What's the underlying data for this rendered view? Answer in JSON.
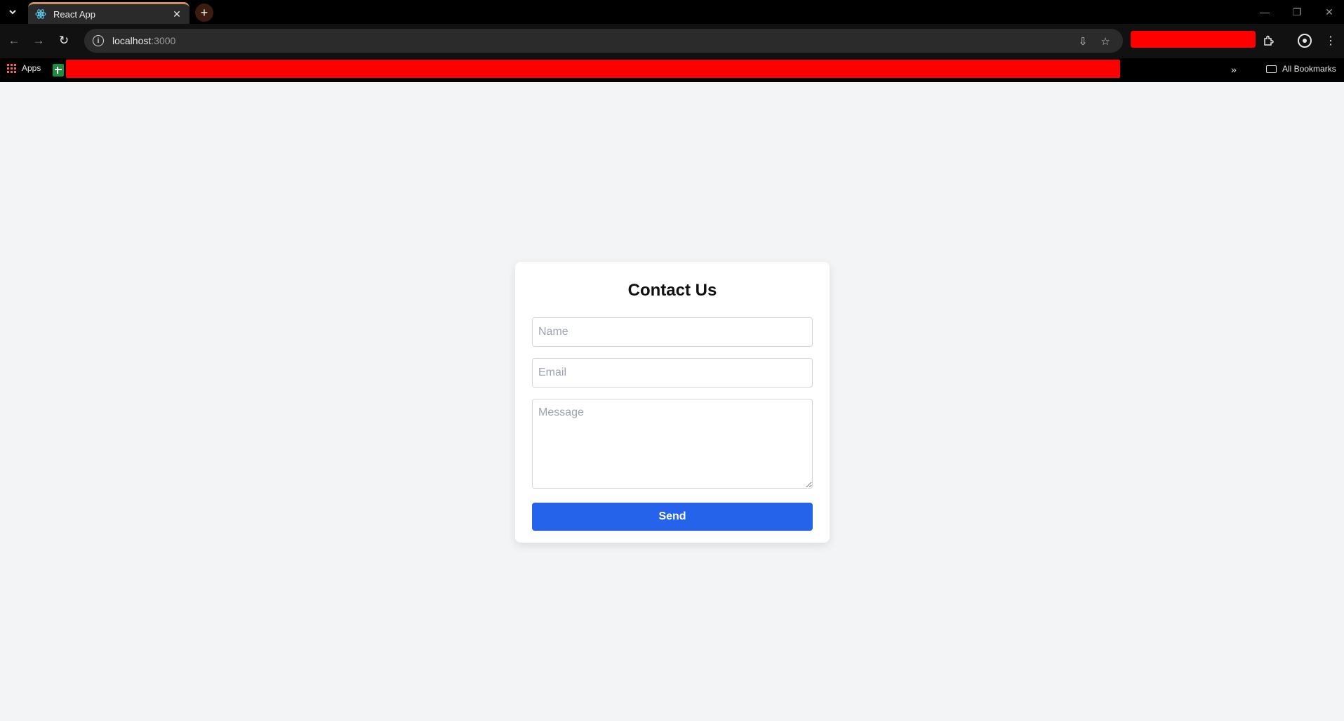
{
  "browser": {
    "tab_title": "React App",
    "new_tab_symbol": "+",
    "url_host": "localhost",
    "url_port": ":3000",
    "bookmarks": {
      "apps_label": "Apps",
      "all_bookmarks_label": "All Bookmarks",
      "overflow_symbol": "»"
    },
    "icons": {
      "tab_favicon": "react-icon",
      "back": "arrow-left-icon",
      "forward": "arrow-right-icon",
      "reload": "reload-icon",
      "site_info": "info-icon",
      "install": "install-icon",
      "bookmark": "star-icon",
      "extensions": "puzzle-icon",
      "profile": "profile-icon",
      "menu": "kebab-menu-icon"
    }
  },
  "page": {
    "heading": "Contact Us",
    "form": {
      "name_placeholder": "Name",
      "email_placeholder": "Email",
      "message_placeholder": "Message",
      "send_label": "Send"
    }
  },
  "colors": {
    "page_background": "#f3f4f6",
    "button_primary": "#2563eb",
    "redaction": "#ff0000"
  }
}
